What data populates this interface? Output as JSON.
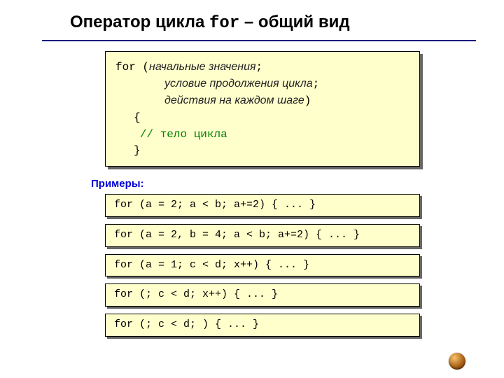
{
  "title": {
    "pre": "Оператор цикла ",
    "keyword": "for",
    "post": " – общий вид"
  },
  "mainSyntax": {
    "l1_kw": "for ",
    "l1_paren": "(",
    "l1_text": "начальные значения",
    "l1_semi": ";",
    "l2_text": "условие продолжения цикла",
    "l2_semi": ";",
    "l3_text": "действия на каждом шаге",
    "l3_paren": ")",
    "l4": "{",
    "l5_comment": "// тело цикла",
    "l6": "}"
  },
  "examplesLabel": "Примеры:",
  "examples": [
    "for (a = 2; a < b; a+=2) { ... }",
    "for (a = 2, b = 4; a < b; a+=2) { ... }",
    "for (a = 1; c < d; x++) { ... }",
    "for (; c < d; x++) { ... }",
    "for (; c < d; ) { ... }"
  ]
}
